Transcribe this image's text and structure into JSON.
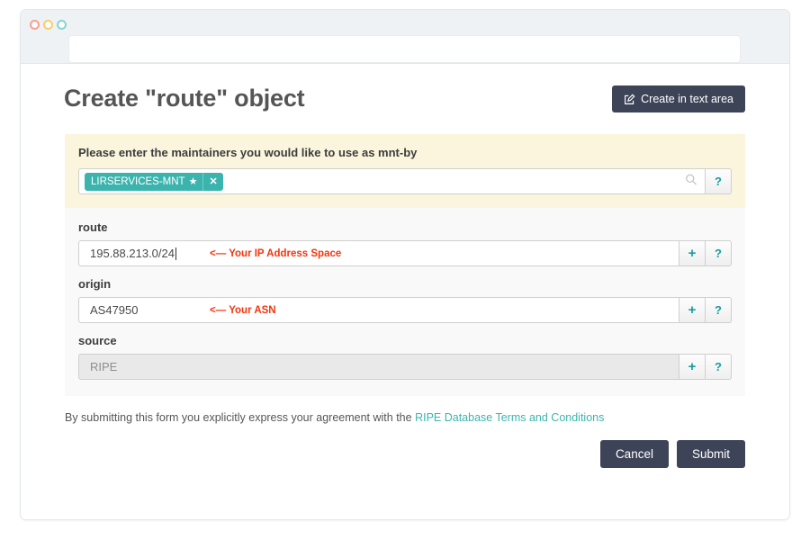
{
  "browser": {
    "address_bar_value": "",
    "address_bar_placeholder": "",
    "traffic_lights": [
      "close-red",
      "minimize-yellow",
      "maximize-teal"
    ]
  },
  "header": {
    "title": "Create \"route\" object",
    "textarea_button": {
      "label": "Create in text area",
      "icon": "edit-square-icon"
    }
  },
  "mnt_panel": {
    "label": "Please enter the maintainers you would like to use as mnt-by",
    "tag": {
      "text": "LIRSERVICES-MNT",
      "star_icon": "star-icon",
      "close_icon": "close-icon"
    },
    "search_icon": "search-icon",
    "help_label": "?",
    "background_color": "#faf5dc"
  },
  "attributes": [
    {
      "label": "route",
      "value": "195.88.213.0/24",
      "annotation": "<— Your IP Address Space",
      "disabled": false,
      "focused": true,
      "add_label": "+",
      "help_label": "?"
    },
    {
      "label": "origin",
      "value": "AS47950",
      "annotation": "<— Your ASN",
      "disabled": false,
      "focused": false,
      "add_label": "+",
      "help_label": "?"
    },
    {
      "label": "source",
      "value": "RIPE",
      "annotation": "",
      "disabled": true,
      "focused": false,
      "add_label": "+",
      "help_label": "?"
    }
  ],
  "footer": {
    "agreement_text": "By submitting this form you explicitly express your agreement with the ",
    "agreement_link": "RIPE Database Terms and Conditions",
    "cancel_label": "Cancel",
    "submit_label": "Submit"
  },
  "colors": {
    "accent_teal": "#3cb4ae",
    "dark_slate": "#3e4458",
    "annotation_red": "#f4350e",
    "panel_yellow": "#faf5dc"
  }
}
